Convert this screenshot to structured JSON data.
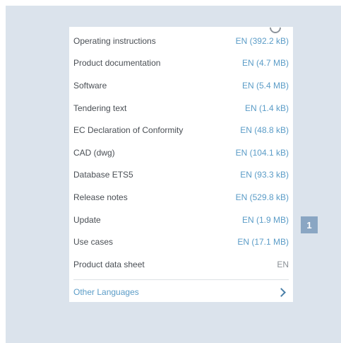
{
  "downloads": [
    {
      "label": "Operating instructions",
      "size": "EN (392.2 kB)"
    },
    {
      "label": "Product documentation",
      "size": "EN (4.7 MB)"
    },
    {
      "label": "Software",
      "size": "EN (5.4 MB)"
    },
    {
      "label": "Tendering text",
      "size": "EN (1.4 kB)"
    },
    {
      "label": "EC Declaration of Conformity",
      "size": "EN (48.8 kB)"
    },
    {
      "label": "CAD (dwg)",
      "size": "EN (104.1 kB)"
    },
    {
      "label": "Database ETS5",
      "size": "EN (93.3 kB)"
    },
    {
      "label": "Release notes",
      "size": "EN (529.8 kB)"
    },
    {
      "label": "Update",
      "size": "EN (1.9 MB)"
    },
    {
      "label": "Use cases",
      "size": "EN (17.1 MB)"
    },
    {
      "label": "Product data sheet",
      "size": "EN"
    }
  ],
  "other_languages": {
    "label": "Other Languages",
    "icon": "chevron-right-icon"
  },
  "marker": {
    "label": "1"
  },
  "colors": {
    "frame": "#dbe3ec",
    "link": "#5b9cc7",
    "text": "#4a4f55",
    "marker": "#8aa6c3"
  }
}
